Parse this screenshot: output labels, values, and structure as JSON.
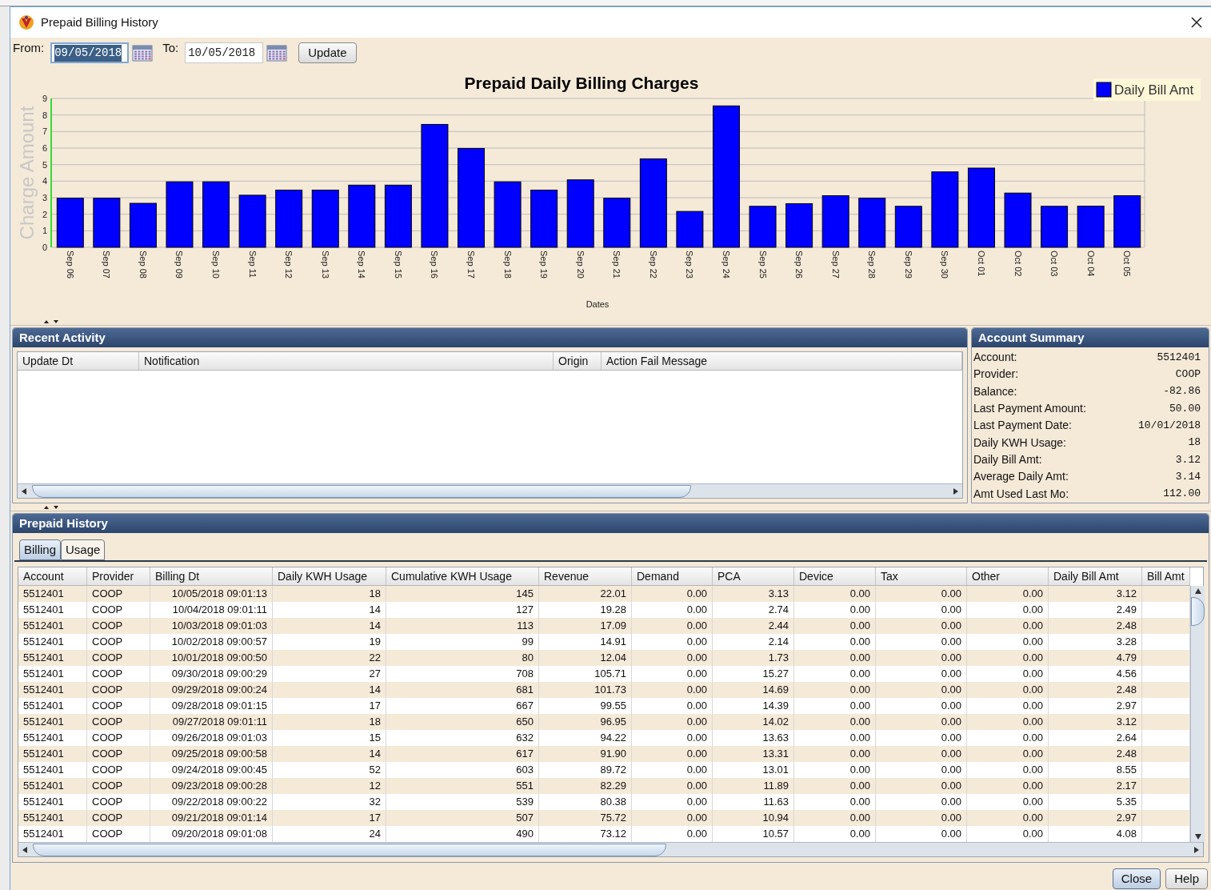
{
  "window": {
    "title": "Prepaid Billing History"
  },
  "toolbar": {
    "from_label": "From:",
    "from_value": "09/05/2018",
    "from_focused": true,
    "to_label": "To:",
    "to_value": "10/05/2018",
    "to_focused": false,
    "update_button": "Update"
  },
  "chart": {
    "chart_data": {
      "type": "bar",
      "title": "Prepaid Daily Billing Charges",
      "xlabel": "Dates",
      "ylabel": "Charge Amount",
      "categories": [
        "Sep 06",
        "Sep 07",
        "Sep 08",
        "Sep 09",
        "Sep 10",
        "Sep 11",
        "Sep 12",
        "Sep 13",
        "Sep 14",
        "Sep 15",
        "Sep 16",
        "Sep 17",
        "Sep 18",
        "Sep 19",
        "Sep 20",
        "Sep 21",
        "Sep 22",
        "Sep 23",
        "Sep 24",
        "Sep 25",
        "Sep 26",
        "Sep 27",
        "Sep 28",
        "Sep 29",
        "Sep 30",
        "Oct 01",
        "Oct 02",
        "Oct 03",
        "Oct 04",
        "Oct 05"
      ],
      "series": [
        {
          "name": "Daily Bill Amt",
          "color": "#0000ff",
          "values": [
            2.97,
            2.97,
            2.66,
            3.96,
            3.96,
            3.15,
            3.46,
            3.46,
            3.76,
            3.76,
            7.43,
            5.98,
            3.96,
            3.46,
            4.08,
            2.97,
            5.35,
            2.17,
            8.55,
            2.48,
            2.64,
            3.12,
            2.97,
            2.48,
            4.56,
            4.79,
            3.28,
            2.48,
            2.49,
            3.12
          ]
        }
      ],
      "grid": true,
      "ylim": [
        0,
        9
      ],
      "yticks": [
        0,
        1,
        2,
        3,
        4,
        5,
        6,
        7,
        8,
        9
      ]
    }
  },
  "recent_activity": {
    "title": "Recent Activity",
    "columns": [
      "Update Dt",
      "Notification",
      "Origin",
      "Action Fail Message"
    ]
  },
  "account_summary": {
    "title": "Account Summary",
    "fields": [
      {
        "label": "Account:",
        "value": "5512401"
      },
      {
        "label": "Provider:",
        "value": "COOP"
      },
      {
        "label": "Balance:",
        "value": "-82.86"
      },
      {
        "label": "Last Payment Amount:",
        "value": "50.00"
      },
      {
        "label": "Last Payment Date:",
        "value": "10/01/2018"
      },
      {
        "label": "Daily KWH Usage:",
        "value": "18"
      },
      {
        "label": "Daily Bill Amt:",
        "value": "3.12"
      },
      {
        "label": "Average Daily Amt:",
        "value": "3.14"
      },
      {
        "label": "Amt Used Last Mo:",
        "value": "112.00"
      }
    ]
  },
  "prepaid_history": {
    "title": "Prepaid History",
    "tabs": [
      {
        "label": "Billing",
        "selected": true
      },
      {
        "label": "Usage",
        "selected": false
      }
    ],
    "columns": [
      "Account",
      "Provider",
      "Billing Dt",
      "Daily KWH Usage",
      "Cumulative KWH Usage",
      "Revenue",
      "Demand",
      "PCA",
      "Device",
      "Tax",
      "Other",
      "Daily Bill Amt",
      "Bill Amt"
    ],
    "rows": [
      [
        "5512401",
        "COOP",
        "10/05/2018 09:01:13",
        "18",
        "145",
        "22.01",
        "0.00",
        "3.13",
        "0.00",
        "0.00",
        "0.00",
        "3.12"
      ],
      [
        "5512401",
        "COOP",
        "10/04/2018 09:01:11",
        "14",
        "127",
        "19.28",
        "0.00",
        "2.74",
        "0.00",
        "0.00",
        "0.00",
        "2.49"
      ],
      [
        "5512401",
        "COOP",
        "10/03/2018 09:01:03",
        "14",
        "113",
        "17.09",
        "0.00",
        "2.44",
        "0.00",
        "0.00",
        "0.00",
        "2.48"
      ],
      [
        "5512401",
        "COOP",
        "10/02/2018 09:00:57",
        "19",
        "99",
        "14.91",
        "0.00",
        "2.14",
        "0.00",
        "0.00",
        "0.00",
        "3.28"
      ],
      [
        "5512401",
        "COOP",
        "10/01/2018 09:00:50",
        "22",
        "80",
        "12.04",
        "0.00",
        "1.73",
        "0.00",
        "0.00",
        "0.00",
        "4.79"
      ],
      [
        "5512401",
        "COOP",
        "09/30/2018 09:00:29",
        "27",
        "708",
        "105.71",
        "0.00",
        "15.27",
        "0.00",
        "0.00",
        "0.00",
        "4.56"
      ],
      [
        "5512401",
        "COOP",
        "09/29/2018 09:00:24",
        "14",
        "681",
        "101.73",
        "0.00",
        "14.69",
        "0.00",
        "0.00",
        "0.00",
        "2.48"
      ],
      [
        "5512401",
        "COOP",
        "09/28/2018 09:01:15",
        "17",
        "667",
        "99.55",
        "0.00",
        "14.39",
        "0.00",
        "0.00",
        "0.00",
        "2.97"
      ],
      [
        "5512401",
        "COOP",
        "09/27/2018 09:01:11",
        "18",
        "650",
        "96.95",
        "0.00",
        "14.02",
        "0.00",
        "0.00",
        "0.00",
        "3.12"
      ],
      [
        "5512401",
        "COOP",
        "09/26/2018 09:01:03",
        "15",
        "632",
        "94.22",
        "0.00",
        "13.63",
        "0.00",
        "0.00",
        "0.00",
        "2.64"
      ],
      [
        "5512401",
        "COOP",
        "09/25/2018 09:00:58",
        "14",
        "617",
        "91.90",
        "0.00",
        "13.31",
        "0.00",
        "0.00",
        "0.00",
        "2.48"
      ],
      [
        "5512401",
        "COOP",
        "09/24/2018 09:00:45",
        "52",
        "603",
        "89.72",
        "0.00",
        "13.01",
        "0.00",
        "0.00",
        "0.00",
        "8.55"
      ],
      [
        "5512401",
        "COOP",
        "09/23/2018 09:00:28",
        "12",
        "551",
        "82.29",
        "0.00",
        "11.89",
        "0.00",
        "0.00",
        "0.00",
        "2.17"
      ],
      [
        "5512401",
        "COOP",
        "09/22/2018 09:00:22",
        "32",
        "539",
        "80.38",
        "0.00",
        "11.63",
        "0.00",
        "0.00",
        "0.00",
        "5.35"
      ],
      [
        "5512401",
        "COOP",
        "09/21/2018 09:01:14",
        "17",
        "507",
        "75.72",
        "0.00",
        "10.94",
        "0.00",
        "0.00",
        "0.00",
        "2.97"
      ],
      [
        "5512401",
        "COOP",
        "09/20/2018 09:01:08",
        "24",
        "490",
        "73.12",
        "0.00",
        "10.57",
        "0.00",
        "0.00",
        "0.00",
        "4.08"
      ]
    ]
  },
  "buttons": [
    "Close",
    "Help"
  ]
}
